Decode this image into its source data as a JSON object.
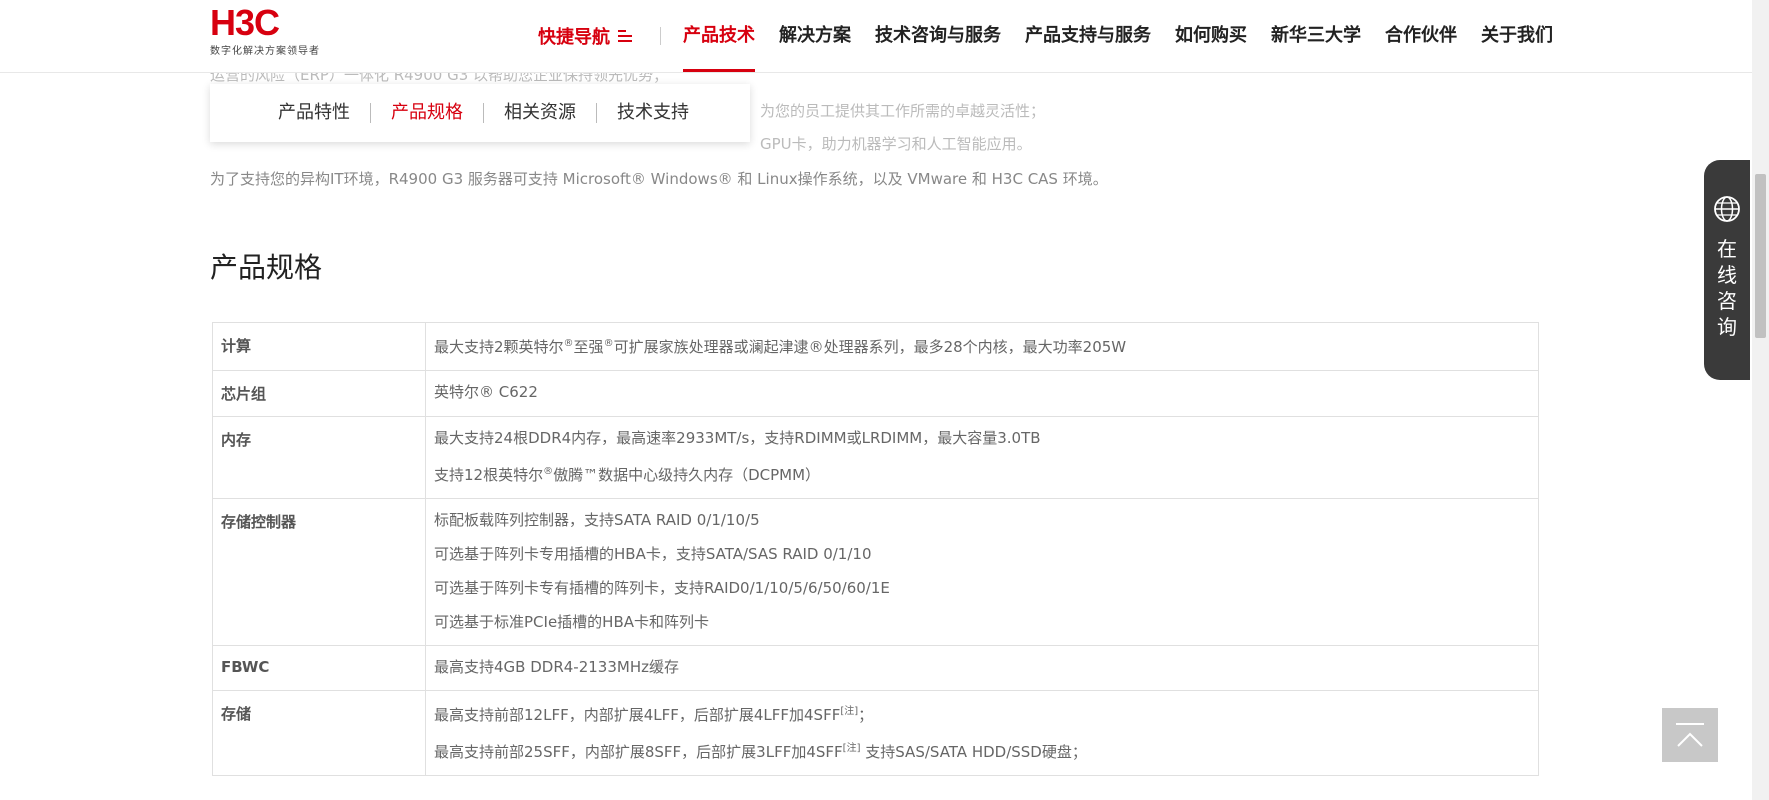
{
  "header": {
    "logo_mark": "H3C",
    "logo_sub": "数字化解决方案领导者",
    "quick_nav": "快捷导航",
    "nav": [
      "产品技术",
      "解决方案",
      "技术咨询与服务",
      "产品支持与服务",
      "如何购买",
      "新华三大学",
      "合作伙伴",
      "关于我们"
    ]
  },
  "intro": {
    "line1": "运营的风险（ERP）一体化 R4900 G3 以帮助您企业保持领先优势；",
    "line2": "为您的员工提供其工作所需的卓越灵活性；",
    "line3": "GPU卡，助力机器学习和人工智能应用。",
    "line4": "为了支持您的异构IT环境，R4900 G3 服务器可支持 Microsoft® Windows® 和 Linux操作系统，以及 VMware 和 H3C CAS 环境。"
  },
  "subnav": [
    "产品特性",
    "产品规格",
    "相关资源",
    "技术支持"
  ],
  "section_title": "产品规格",
  "specs": {
    "compute": {
      "label": "计算",
      "l1_a": "最大支持2颗英特尔",
      "l1_sup1": "®",
      "l1_b": "至强",
      "l1_sup2": "®",
      "l1_c": "可扩展家族处理器或澜起津逮®处理器系列，最多28个内核，最大功率205W"
    },
    "chipset": {
      "label": "芯片组",
      "l1": "英特尔® C622"
    },
    "memory": {
      "label": "内存",
      "l1": "最大支持24根DDR4内存，最高速率2933MT/s，支持RDIMM或LRDIMM，最大容量3.0TB",
      "l2_a": "支持12根英特尔",
      "l2_sup": "®",
      "l2_b": "傲腾™数据中心级持久内存（DCPMM）"
    },
    "controller": {
      "label": "存储控制器",
      "l1": "标配板载阵列控制器，支持SATA RAID 0/1/10/5",
      "l2": "可选基于阵列卡专用插槽的HBA卡，支持SATA/SAS RAID 0/1/10",
      "l3": "可选基于阵列卡专有插槽的阵列卡，支持RAID0/1/10/5/6/50/60/1E",
      "l4": "可选基于标准PCIe插槽的HBA卡和阵列卡"
    },
    "fbwc": {
      "label": "FBWC",
      "l1": "最高支持4GB DDR4-2133MHz缓存"
    },
    "storage": {
      "label": "存储",
      "l1_a": "最高支持前部12LFF，内部扩展4LFF，后部扩展4LFF加4SFF",
      "l1_sup": "[注]",
      "l1_b": "；",
      "l2_a": "最高支持前部25SFF，内部扩展8SFF，后部扩展3LFF加4SFF",
      "l2_sup": "[注]",
      "l2_b": " 支持SAS/SATA HDD/SSD硬盘；"
    }
  },
  "consult": "在线咨询"
}
